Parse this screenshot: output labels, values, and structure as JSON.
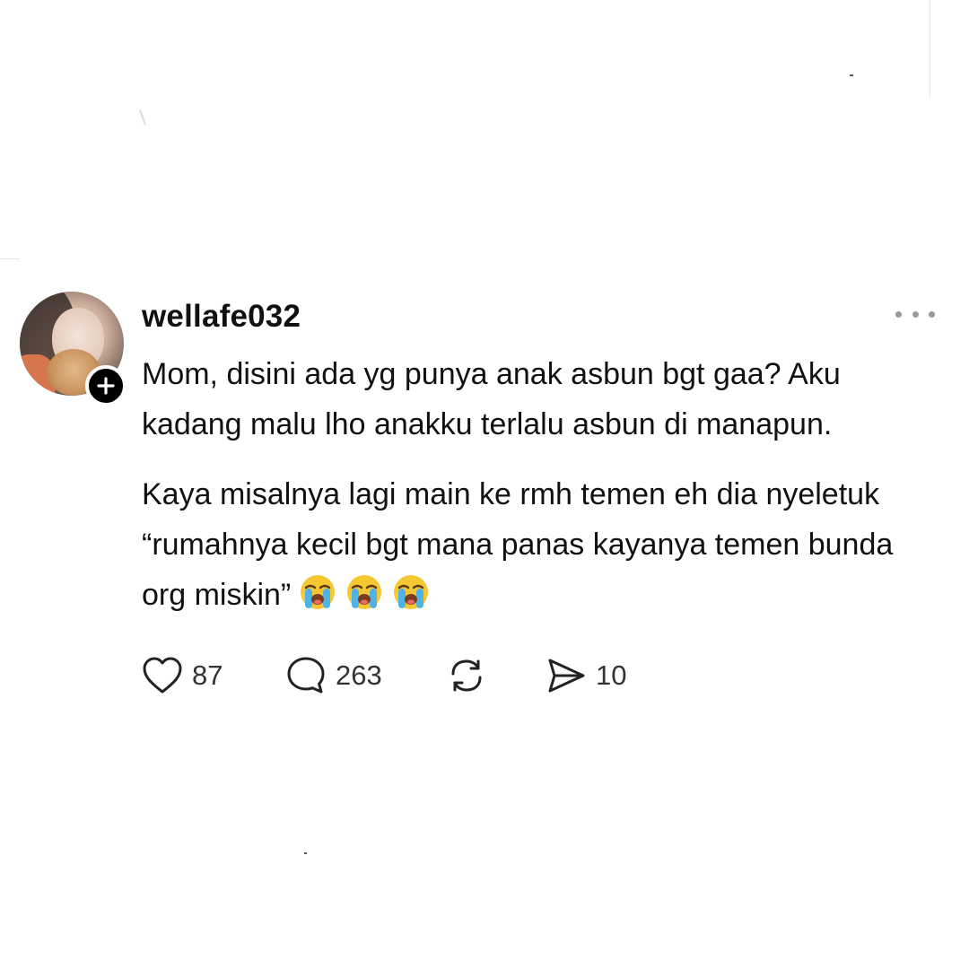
{
  "post": {
    "username": "wellafe032",
    "paragraphs": [
      "Mom, disini ada yg punya anak asbun bgt gaa? Aku kadang malu lho anakku terlalu asbun di manapun.",
      "Kaya misalnya lagi main ke rmh temen eh dia nyeletuk “rumahnya kecil bgt mana panas kayanya temen bunda org miskin”"
    ],
    "emoji_icon": "loudly-crying-face-icon",
    "emoji_count": 3
  },
  "actions": {
    "like_count": "87",
    "reply_count": "263",
    "share_count": "10"
  },
  "icons": {
    "like": "heart-icon",
    "reply": "speech-bubble-icon",
    "repost": "repost-icon",
    "share": "send-icon",
    "more": "more-dots-icon",
    "follow": "plus-icon"
  },
  "colors": {
    "text": "#111111",
    "muted": "#9a9a9a",
    "badge": "#000000"
  }
}
